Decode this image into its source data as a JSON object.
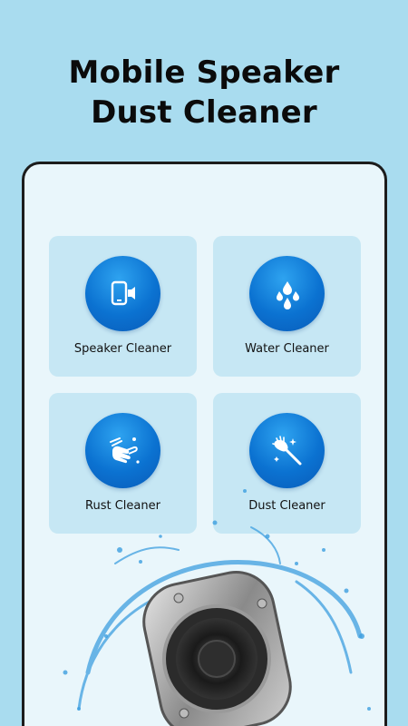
{
  "headline": {
    "line1": "Mobile Speaker",
    "line2": "Dust Cleaner"
  },
  "cards": [
    {
      "label": "Speaker Cleaner",
      "icon": "speaker-phone-icon"
    },
    {
      "label": "Water Cleaner",
      "icon": "water-drops-icon"
    },
    {
      "label": "Rust Cleaner",
      "icon": "washing-hands-icon"
    },
    {
      "label": "Dust Cleaner",
      "icon": "duster-icon"
    }
  ],
  "colors": {
    "background": "#a9dcef",
    "panel": "#e9f6fb",
    "card": "#c6e7f4",
    "accent": "#0b72d1"
  }
}
